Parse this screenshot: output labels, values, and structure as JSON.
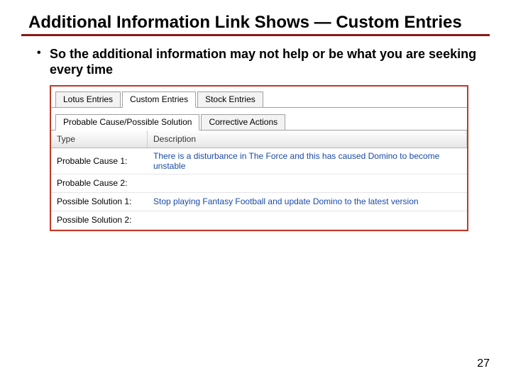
{
  "title": "Additional Information Link Shows — Custom Entries",
  "bullet": "So the additional information may not help or be what you are seeking every time",
  "tabs": {
    "top": [
      "Lotus Entries",
      "Custom Entries",
      "Stock Entries"
    ],
    "top_active": 1,
    "sub": [
      "Probable Cause/Possible Solution",
      "Corrective Actions"
    ],
    "sub_active": 0
  },
  "columns": {
    "type": "Type",
    "desc": "Description"
  },
  "rows": [
    {
      "type": "Probable Cause 1:",
      "desc": "There is a disturbance in The Force and this has caused Domino to become unstable"
    },
    {
      "type": "Probable Cause 2:",
      "desc": ""
    },
    {
      "type": "Possible Solution 1:",
      "desc": "Stop playing Fantasy Football and update Domino to the latest version"
    },
    {
      "type": "Possible Solution 2:",
      "desc": ""
    }
  ],
  "page": "27"
}
